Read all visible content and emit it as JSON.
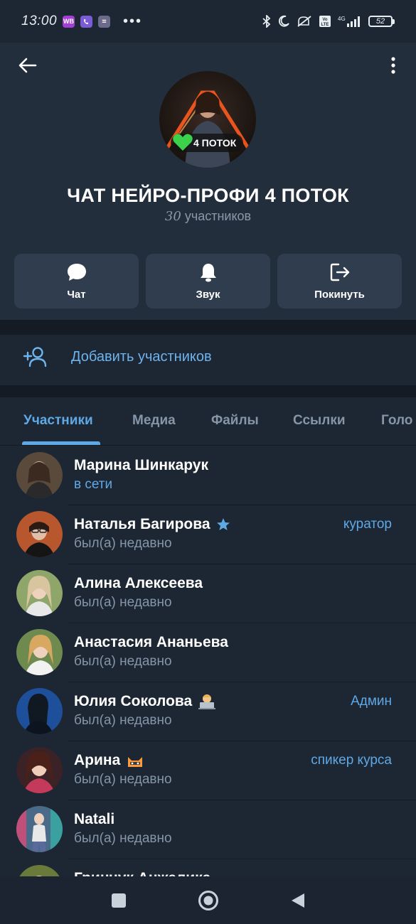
{
  "status_bar": {
    "time": "13:00",
    "badge_wb": "WB",
    "battery": "52"
  },
  "header": {
    "title": "ЧАТ НЕЙРО-ПРОФИ 4 ПОТОК",
    "member_count": "30",
    "member_count_suffix": " участников",
    "avatar_badge": "4 ПОТОК"
  },
  "actions": [
    {
      "label": "Чат",
      "icon": "chat-bubble-icon"
    },
    {
      "label": "Звук",
      "icon": "bell-icon"
    },
    {
      "label": "Покинуть",
      "icon": "leave-icon"
    }
  ],
  "add_members": {
    "label": "Добавить участников",
    "icon": "add-user-icon"
  },
  "tabs": [
    "Участники",
    "Медиа",
    "Файлы",
    "Ссылки",
    "Голо"
  ],
  "members": [
    {
      "name": "Марина Шинкарук",
      "status": "в сети",
      "online": true,
      "role": "",
      "color": "#5a4a3c"
    },
    {
      "name": "Наталья Багирова",
      "status": "был(а) недавно",
      "online": false,
      "role": "куратор",
      "color": "#b8572e"
    },
    {
      "name": "Алина Алексеева",
      "status": "был(а) недавно",
      "online": false,
      "role": "",
      "color": "#8fa66a"
    },
    {
      "name": "Анастасия Ананьева",
      "status": "был(а) недавно",
      "online": false,
      "role": "",
      "color": "#6f8a4e"
    },
    {
      "name": "Юлия Соколова",
      "status": "был(а) недавно",
      "online": false,
      "role": "Админ",
      "color": "#1e4f9a"
    },
    {
      "name": "Арина",
      "status": "был(а) недавно",
      "online": false,
      "role": "спикер курса",
      "color": "#7a3a4a"
    },
    {
      "name": "Natali",
      "status": "был(а) недавно",
      "online": false,
      "role": "",
      "color": "#4a6a8a"
    },
    {
      "name": "Гринчук Анжелика",
      "status": "",
      "online": false,
      "role": "",
      "color": "#6a7a3a"
    }
  ]
}
